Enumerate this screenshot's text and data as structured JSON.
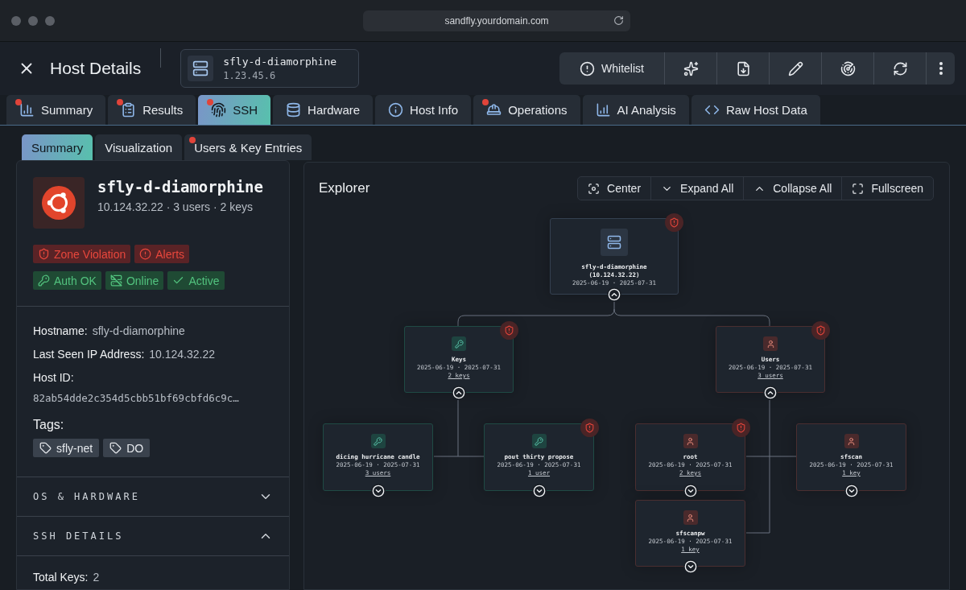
{
  "browser": {
    "url": "sandfly.yourdomain.com"
  },
  "header": {
    "title": "Host Details",
    "host": {
      "name": "sfly-d-diamorphine",
      "ip": "1.23.45.6"
    },
    "actions": [
      {
        "kind": "whitelist",
        "label": "Whitelist"
      },
      {
        "kind": "ai"
      },
      {
        "kind": "download"
      },
      {
        "kind": "edit"
      },
      {
        "kind": "scan"
      },
      {
        "kind": "refresh"
      },
      {
        "kind": "more"
      }
    ]
  },
  "tabs": [
    {
      "label": "Summary",
      "selected": false,
      "alert": true
    },
    {
      "label": "Results",
      "selected": false,
      "alert": true
    },
    {
      "label": "SSH",
      "selected": true,
      "alert": true
    },
    {
      "label": "Hardware",
      "selected": false,
      "alert": false
    },
    {
      "label": "Host Info",
      "selected": false,
      "alert": false
    },
    {
      "label": "Operations",
      "selected": false,
      "alert": true
    },
    {
      "label": "AI Analysis",
      "selected": false,
      "alert": false
    },
    {
      "label": "Raw Host Data",
      "selected": false,
      "alert": false
    }
  ],
  "subtabs": [
    {
      "label": "Summary",
      "selected": true,
      "alert": false
    },
    {
      "label": "Visualization",
      "selected": false,
      "alert": false
    },
    {
      "label": "Users & Key Entries",
      "selected": false,
      "alert": true
    }
  ],
  "host_card": {
    "name": "sfly-d-diamorphine",
    "meta": "10.124.32.22  ·  3 users  ·  2 keys",
    "badges": [
      {
        "label": "Zone Violation",
        "kind": "danger"
      },
      {
        "label": "Alerts",
        "kind": "danger"
      },
      {
        "label": "Auth OK",
        "kind": "success"
      },
      {
        "label": "Online",
        "kind": "success"
      },
      {
        "label": "Active",
        "kind": "success"
      }
    ]
  },
  "details": [
    {
      "label": "Hostname:",
      "value": "sfly-d-diamorphine",
      "kind": "inline"
    },
    {
      "label": "Last Seen IP Address:",
      "value": "10.124.32.22",
      "kind": "inline"
    },
    {
      "label": "Host ID:",
      "value": "82ab54dde2c354d5cbb51bf69cbfd6c9c…",
      "kind": "block"
    }
  ],
  "tags": {
    "label": "Tags:",
    "items": [
      "sfly-net",
      "DO"
    ]
  },
  "sections": [
    {
      "title": "OS & HARDWARE",
      "expanded": false
    },
    {
      "title": "SSH DETAILS",
      "expanded": true
    }
  ],
  "ssh_details": [
    {
      "label": "Total Keys:",
      "value": "2"
    }
  ],
  "explorer": {
    "title": "Explorer",
    "controls": [
      {
        "label": "Center"
      },
      {
        "label": "Expand All"
      },
      {
        "label": "Collapse All"
      },
      {
        "label": "Fullscreen"
      }
    ],
    "tree": {
      "kind": "host",
      "title": "sfly-d-diamorphine",
      "subtitle": "(10.124.32.22)",
      "dates": "2025-06-19 · 2025-07-31",
      "alert": true,
      "expanded": true,
      "children": [
        {
          "kind": "key",
          "title": "Keys",
          "dates": "2025-06-19 · 2025-07-31",
          "count": "2 keys",
          "alert": true,
          "expanded": true,
          "children": [
            {
              "kind": "key",
              "title": "dicing hurricane candle",
              "dates": "2025-06-19 · 2025-07-31",
              "count": "3 users",
              "alert": false,
              "expanded": false
            },
            {
              "kind": "key",
              "title": "pout thirty propose",
              "dates": "2025-06-19 · 2025-07-31",
              "count": "1 user",
              "alert": true,
              "expanded": false
            }
          ]
        },
        {
          "kind": "user",
          "title": "Users",
          "dates": "2025-06-19 · 2025-07-31",
          "count": "3 users",
          "alert": true,
          "expanded": true,
          "children": [
            {
              "kind": "user",
              "title": "root",
              "dates": "2025-06-19 · 2025-07-31",
              "count": "2 keys",
              "alert": true,
              "expanded": false
            },
            {
              "kind": "user",
              "title": "sfscan",
              "dates": "2025-06-19 · 2025-07-31",
              "count": "1 key",
              "alert": false,
              "expanded": false
            },
            {
              "kind": "user",
              "title": "sfscanpw",
              "dates": "2025-06-19 · 2025-07-31",
              "count": "1 key",
              "alert": false,
              "expanded": false
            }
          ]
        }
      ]
    }
  }
}
